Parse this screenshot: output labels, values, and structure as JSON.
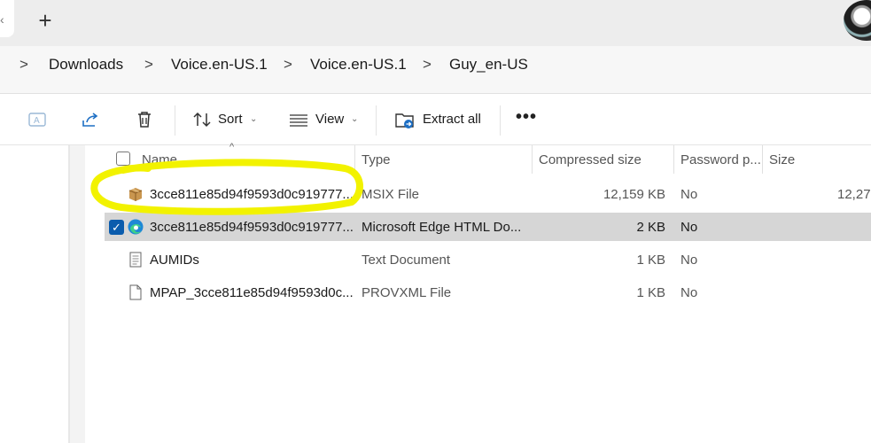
{
  "tabs": {
    "new_tab_glyph": "+",
    "partial_tab_glyph": "‹"
  },
  "breadcrumb": {
    "items": [
      "Downloads",
      "Voice.en-US.1",
      "Voice.en-US.1",
      "Guy_en-US"
    ],
    "separator": ">"
  },
  "toolbar": {
    "sort_label": "Sort",
    "view_label": "View",
    "extract_label": "Extract all",
    "more_label": "•••",
    "chevron": "⌄"
  },
  "columns": {
    "name": "Name",
    "type": "Type",
    "compressed": "Compressed size",
    "password": "Password p...",
    "size": "Size",
    "sort_indicator": "^"
  },
  "files": [
    {
      "name": "3cce811e85d94f9593d0c919777...",
      "type": "MSIX File",
      "compressed": "12,159 KB",
      "password": "No",
      "size": "12,27",
      "icon": "package-icon",
      "selected": false
    },
    {
      "name": "3cce811e85d94f9593d0c919777...",
      "type": "Microsoft Edge HTML Do...",
      "compressed": "2 KB",
      "password": "No",
      "size": "",
      "icon": "edge-icon",
      "selected": true,
      "check": "✓"
    },
    {
      "name": "AUMIDs",
      "type": "Text Document",
      "compressed": "1 KB",
      "password": "No",
      "size": "",
      "icon": "text-document-icon",
      "selected": false
    },
    {
      "name": "MPAP_3cce811e85d94f9593d0c...",
      "type": "PROVXML File",
      "compressed": "1 KB",
      "password": "No",
      "size": "",
      "icon": "document-icon",
      "selected": false
    }
  ],
  "colors": {
    "highlight": "#f2f200",
    "selection": "#d6d6d6",
    "checkbox": "#0b5cad",
    "accent_blue": "#1d6fc4"
  }
}
